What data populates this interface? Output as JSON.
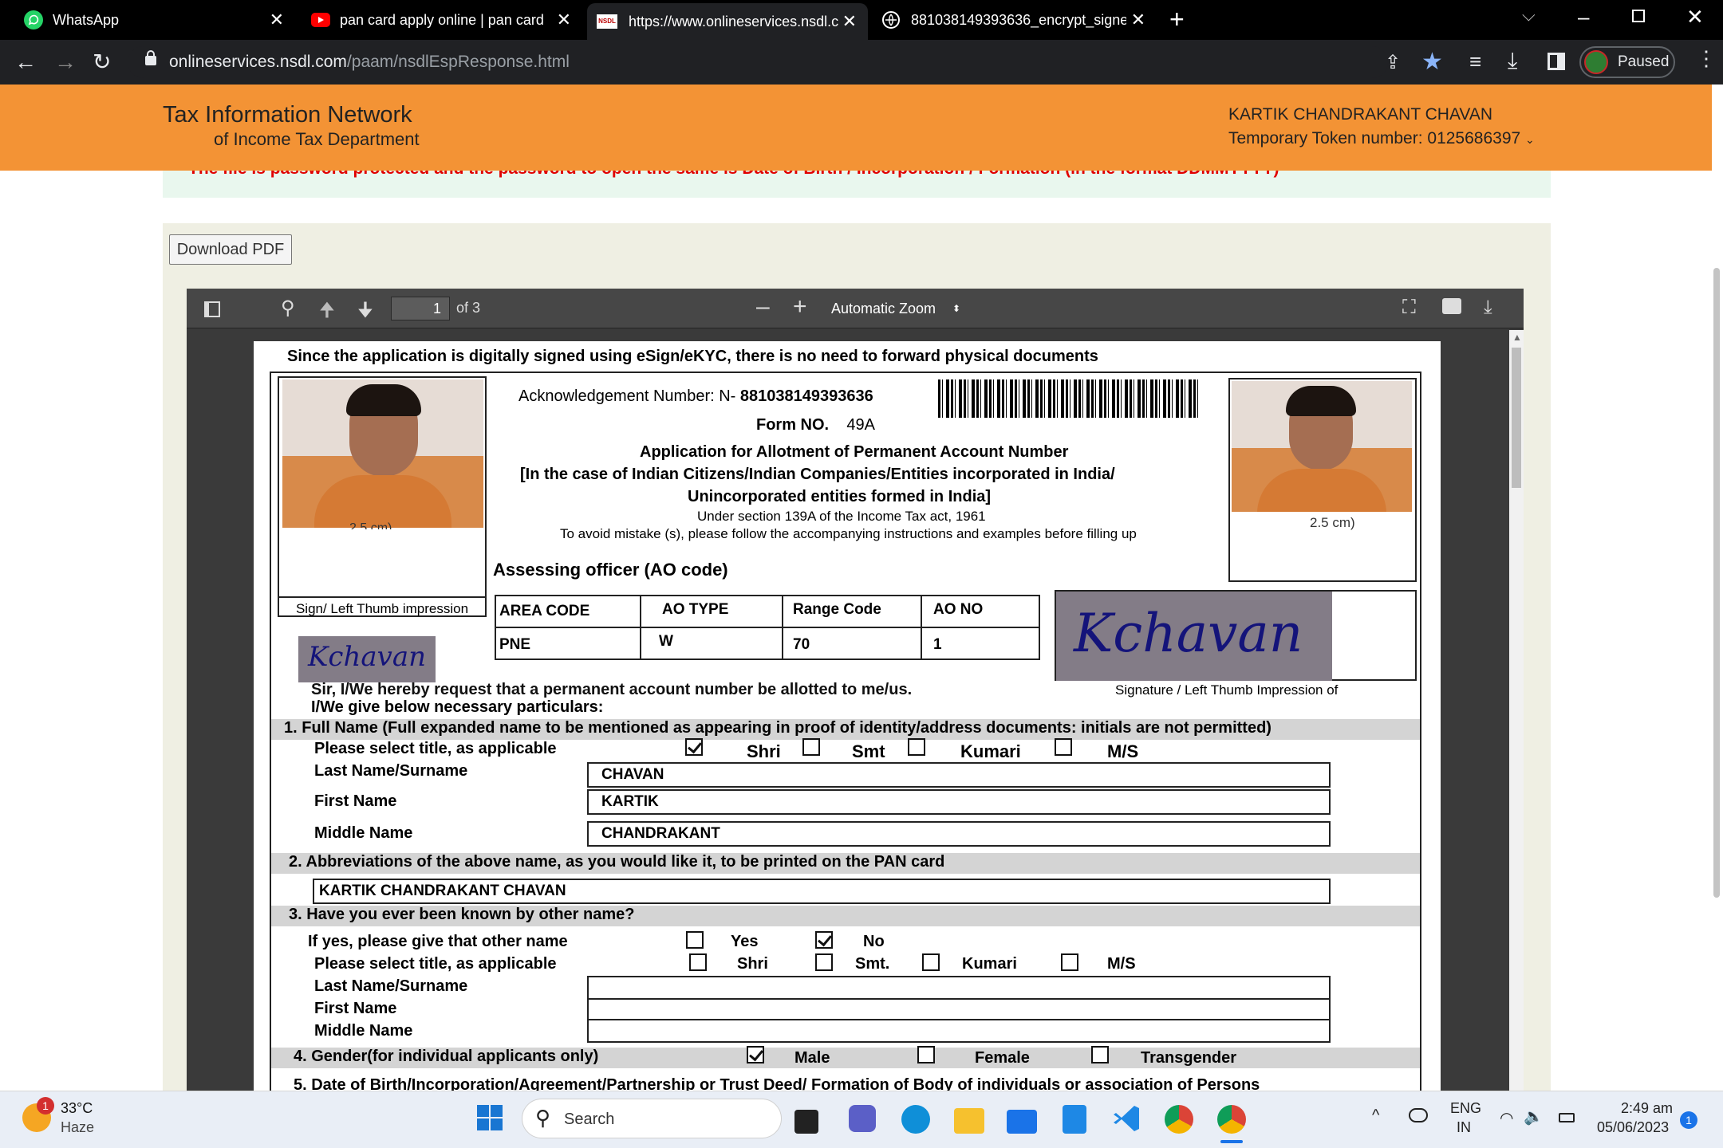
{
  "browser": {
    "tabs": [
      {
        "title": "WhatsApp",
        "icon": "whatsapp-icon"
      },
      {
        "title": "pan card apply online | pan card",
        "icon": "youtube-icon"
      },
      {
        "title": "https://www.onlineservices.nsdl.c",
        "icon": "nsdl-icon",
        "favicon_text": "NSDL"
      },
      {
        "title": "881038149393636_encrypt_signe",
        "icon": "globe-icon"
      }
    ],
    "url_host": "onlineservices.nsdl.com",
    "url_path": "/paam/nsdlEspResponse.html",
    "profile_status": "Paused"
  },
  "header": {
    "brand_line1": "Tax Information Network",
    "brand_line2": "of Income Tax Department",
    "user_name": "KARTIK CHANDRAKANT CHAVAN",
    "token_label": "Temporary Token number: 0125686397"
  },
  "notice": "The file is password protected and the password to open the same is Date of Birth / Incorporation / Formation (in the format DDMMYYYY)",
  "download_button": "Download PDF",
  "pdf_toolbar": {
    "page": "1",
    "page_of": "of 3",
    "zoom": "Automatic Zoom"
  },
  "form": {
    "banner": "Since the application is digitally signed using eSign/eKYC, there is no need to forward physical documents",
    "ack_label": "Acknowledgement Number: N-",
    "ack_number": "881038149393636",
    "form_no_label": "Form NO.",
    "form_no": "49A",
    "title1": "Application for Allotment of Permanent Account Number",
    "title2": "[In the case of Indian Citizens/Indian Companies/Entities incorporated in India/",
    "title3": "Unincorporated entities formed in India]",
    "section": "Under section 139A of the Income Tax act, 1961",
    "instruction": "To avoid mistake (s), please follow the accompanying instructions and examples before filling up",
    "photo_left_caption": "2.5 cm)",
    "photo_right_caption": "2.5 cm)",
    "sign_left_label": "Sign/ Left Thumb impression",
    "sign_right_label": "Signature / Left Thumb Impression of",
    "signature_text": "Kchavan",
    "ao_heading": "Assessing officer (AO code)",
    "ao_headers": [
      "AREA CODE",
      "AO TYPE",
      "Range Code",
      "AO NO"
    ],
    "ao_values": [
      "PNE",
      "W",
      "70",
      "1"
    ],
    "request1": "Sir, I/We hereby request that a permanent account number be allotted to me/us.",
    "request2": "I/We give below necessary particulars:",
    "q1": "1.  Full Name (Full expanded name to be mentioned as appearing in proof of identity/address documents: initials are not permitted)",
    "title_label": "Please select title, as applicable",
    "title_options": [
      "Shri",
      "Smt",
      "Kumari",
      "M/S"
    ],
    "last_name_label": "Last  Name/Surname",
    "last_name": "CHAVAN",
    "first_name_label": "First Name",
    "first_name": "KARTIK",
    "middle_name_label": "Middle Name",
    "middle_name": "CHANDRAKANT",
    "q2": "2.   Abbreviations of the above name, as you would like it, to be printed on the PAN card",
    "abbrev": "KARTIK CHANDRAKANT CHAVAN",
    "q3": "3.  Have you ever been known by other name?",
    "other_name_label": "If yes, please give that other name",
    "yes": "Yes",
    "no": "No",
    "title_options2": [
      "Shri",
      "Smt.",
      "Kumari",
      "M/S"
    ],
    "last_name_label2": "Last Name/Surname",
    "first_name_label2": "First Name",
    "middle_name_label2": "Middle Name",
    "q4": "4.   Gender(for individual  applicants only)",
    "genders": [
      "Male",
      "Female",
      "Transgender"
    ],
    "q5": "5.   Date of Birth/Incorporation/Agreement/Partnership or Trust Deed/ Formation of Body of individuals or association of Persons"
  },
  "taskbar": {
    "temp": "33°C",
    "weather": "Haze",
    "weather_badge": "1",
    "search": "Search",
    "lang1": "ENG",
    "lang2": "IN",
    "time": "2:49 am",
    "date": "05/06/2023",
    "notif": "1"
  },
  "colors": {
    "nsdl_orange": "#f39335",
    "pdf_dark": "#3a3a3a",
    "star_blue": "#8ab4f8",
    "taskbar": "#e9eef6"
  }
}
